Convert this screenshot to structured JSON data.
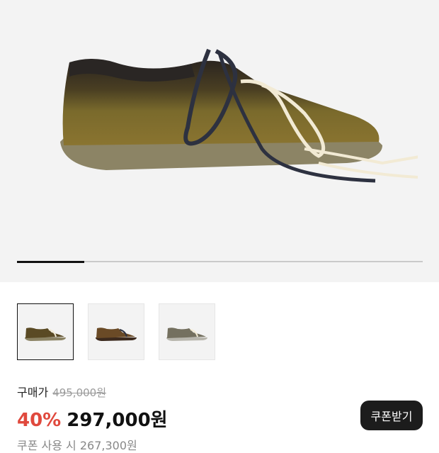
{
  "colors": {
    "accent_discount": "#e0493d",
    "button_bg": "#1c1c1c",
    "hero_bg": "#f3f3f3"
  },
  "gallery": {
    "progress_fraction": 0.165,
    "thumbnails": [
      {
        "variant": "olive-suede-white-lace",
        "selected": true
      },
      {
        "variant": "brown-suede-navy",
        "selected": false
      },
      {
        "variant": "gray-suede-white-lace",
        "selected": false
      }
    ]
  },
  "price": {
    "label": "구매가",
    "original": "495,000원",
    "discount": "40%",
    "sale": "297,000원",
    "coupon_text": "쿠폰 사용 시 267,300원"
  },
  "coupon_button": {
    "label": "쿠폰받기"
  }
}
